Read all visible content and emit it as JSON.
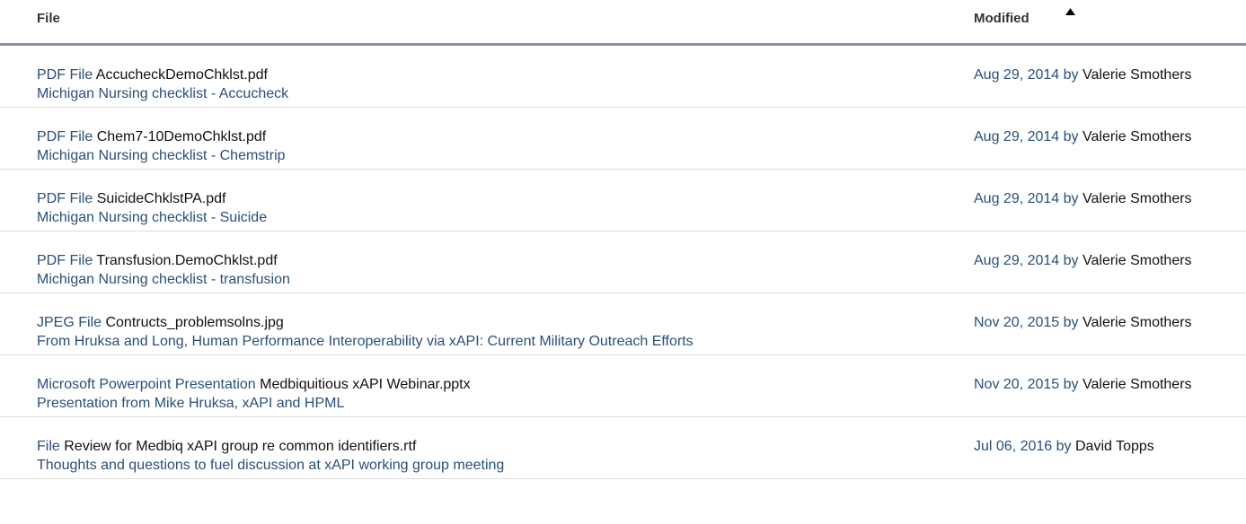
{
  "columns": {
    "file": "File",
    "modified": "Modified"
  },
  "sort_icon": "sort-ascending-icon",
  "colors": {
    "link": "#2a4f7a",
    "header_border": "#8593a1"
  },
  "rows": [
    {
      "type": "PDF File",
      "filename": "AccucheckDemoChklst.pdf",
      "description": "Michigan Nursing checklist - Accucheck",
      "date": "Aug 29, 2014",
      "by": "by",
      "author": "Valerie Smothers"
    },
    {
      "type": "PDF File",
      "filename": "Chem7-10DemoChklst.pdf",
      "description": "Michigan Nursing checklist - Chemstrip",
      "date": "Aug 29, 2014",
      "by": "by",
      "author": "Valerie Smothers"
    },
    {
      "type": "PDF File",
      "filename": "SuicideChklstPA.pdf",
      "description": "Michigan Nursing checklist - Suicide",
      "date": "Aug 29, 2014",
      "by": "by",
      "author": "Valerie Smothers"
    },
    {
      "type": "PDF File",
      "filename": "Transfusion.DemoChklst.pdf",
      "description": "Michigan Nursing checklist - transfusion",
      "date": "Aug 29, 2014",
      "by": "by",
      "author": "Valerie Smothers"
    },
    {
      "type": "JPEG File",
      "filename": "Contructs_problemsolns.jpg",
      "description": "From Hruksa and Long, Human Performance Interoperability via xAPI: Current Military Outreach Efforts",
      "date": "Nov 20, 2015",
      "by": "by",
      "author": "Valerie Smothers"
    },
    {
      "type": "Microsoft Powerpoint Presentation",
      "filename": "Medbiquitious xAPI Webinar.pptx",
      "description": "Presentation from Mike Hruksa, xAPI and HPML",
      "date": "Nov 20, 2015",
      "by": "by",
      "author": "Valerie Smothers"
    },
    {
      "type": "File",
      "filename": "Review for Medbiq xAPI group re common identifiers.rtf",
      "description": "Thoughts and questions to fuel discussion at xAPI working group meeting",
      "date": "Jul 06, 2016",
      "by": "by",
      "author": "David Topps"
    }
  ]
}
